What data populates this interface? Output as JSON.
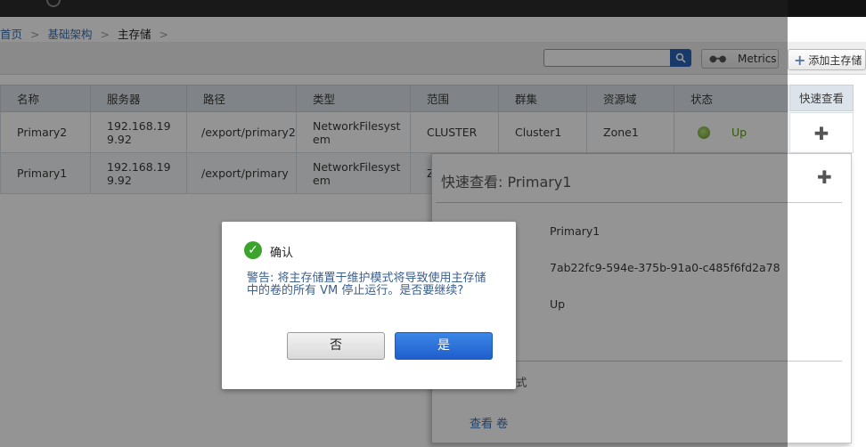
{
  "breadcrumb": [
    {
      "label": "首页",
      "current": false
    },
    {
      "label": "基础架构",
      "current": false
    },
    {
      "label": "主存储",
      "current": true
    }
  ],
  "breadcrumb_sep": ">",
  "toolbar": {
    "search_value": "",
    "search_placeholder": "",
    "metrics_label": "Metrics",
    "add_label": "添加主存储"
  },
  "table": {
    "columns": [
      "名称",
      "服务器",
      "路径",
      "类型",
      "范围",
      "群集",
      "资源域",
      "状态"
    ],
    "quickview_column": "快速查看",
    "rows": [
      {
        "name": "Primary2",
        "server": "192.168.199.92",
        "path": "/export/primary2",
        "type": "NetworkFilesystem",
        "scope": "CLUSTER",
        "cluster": "Cluster1",
        "zone": "Zone1",
        "state": "Up"
      },
      {
        "name": "Primary1",
        "server": "192.168.199.92",
        "path": "/export/primary",
        "type": "NetworkFilesystem",
        "scope": "Z",
        "cluster": "",
        "zone": "",
        "state": ""
      }
    ]
  },
  "quickview": {
    "title": "快速查看: Primary1",
    "name": "Primary1",
    "id": "7ab22fc9-594e-375b-91a0-c485f6fd2a78",
    "state": "Up",
    "maintenance_fragment": "式",
    "view_volumes_link": "查看 卷"
  },
  "dialog": {
    "title": "确认",
    "message": "警告: 将主存储置于维护模式将导致使用主存储中的卷的所有 VM 停止运行。是否要继续?",
    "no_label": "否",
    "yes_label": "是"
  },
  "colors": {
    "topbar": "#2b2b2b",
    "link": "#3a6fb0",
    "status_up": "#5a9a1a",
    "primary_button": "#1f5fcc",
    "confirm_icon": "#3aa52a"
  }
}
